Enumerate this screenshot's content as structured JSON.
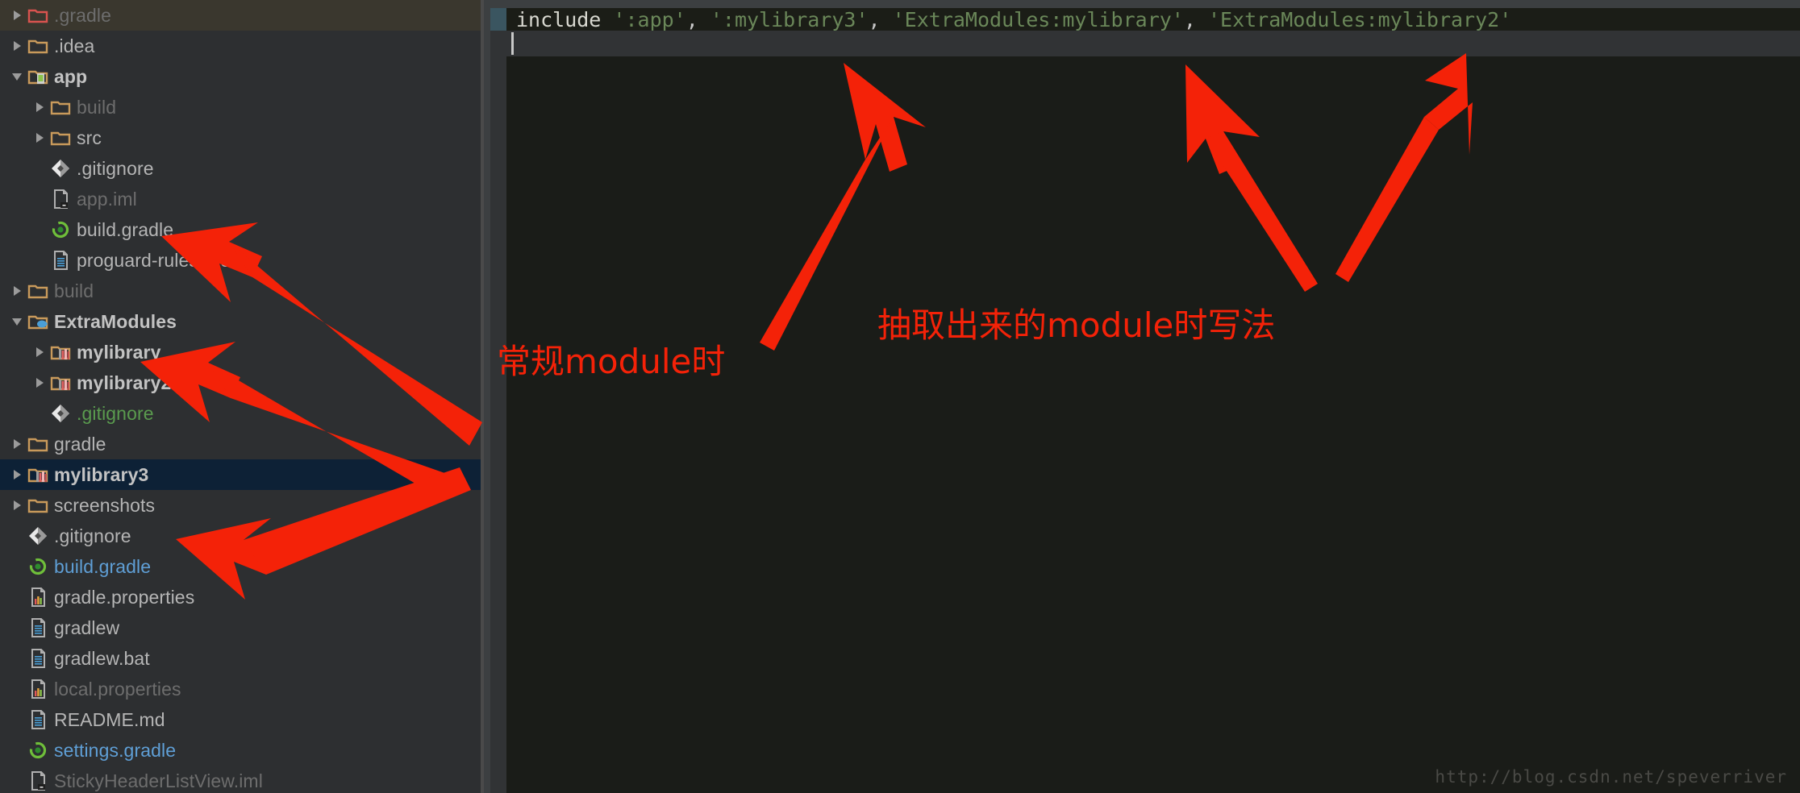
{
  "window": {
    "accent_red": "#f42208",
    "selection_bg": "#0d2136",
    "hover_bg": "#3a372e",
    "panel_bg": "#2d2f31",
    "editor_bg": "#1a1c18"
  },
  "tree": {
    "name": "project-tree",
    "items": [
      {
        "label": ".gradle",
        "indent": 0,
        "twisty": "collapsed",
        "icon": "folder-red-icon",
        "style": "dim",
        "state": "hovered"
      },
      {
        "label": ".idea",
        "indent": 0,
        "twisty": "collapsed",
        "icon": "folder-icon",
        "style": "normal",
        "state": "none"
      },
      {
        "label": "app",
        "indent": 0,
        "twisty": "expanded",
        "icon": "folder-module-icon",
        "style": "bold",
        "state": "none"
      },
      {
        "label": "build",
        "indent": 1,
        "twisty": "collapsed",
        "icon": "folder-icon",
        "style": "dim",
        "state": "none"
      },
      {
        "label": "src",
        "indent": 1,
        "twisty": "collapsed",
        "icon": "folder-icon",
        "style": "normal",
        "state": "none"
      },
      {
        "label": ".gitignore",
        "indent": 1,
        "twisty": "none",
        "icon": "git-icon",
        "style": "normal",
        "state": "none"
      },
      {
        "label": "app.iml",
        "indent": 1,
        "twisty": "none",
        "icon": "iml-file-icon",
        "style": "dim",
        "state": "none"
      },
      {
        "label": "build.gradle",
        "indent": 1,
        "twisty": "none",
        "icon": "gradle-icon",
        "style": "normal",
        "state": "none"
      },
      {
        "label": "proguard-rules.pro",
        "indent": 1,
        "twisty": "none",
        "icon": "text-file-icon",
        "style": "normal",
        "state": "none"
      },
      {
        "label": "build",
        "indent": 0,
        "twisty": "collapsed",
        "icon": "folder-icon",
        "style": "dim",
        "state": "none"
      },
      {
        "label": "ExtraModules",
        "indent": 0,
        "twisty": "expanded",
        "icon": "folder-java-icon",
        "style": "bold",
        "state": "none"
      },
      {
        "label": "mylibrary",
        "indent": 1,
        "twisty": "collapsed",
        "icon": "folder-library-icon",
        "style": "bold",
        "state": "none"
      },
      {
        "label": "mylibrary2",
        "indent": 1,
        "twisty": "collapsed",
        "icon": "folder-library-icon",
        "style": "bold",
        "state": "none"
      },
      {
        "label": ".gitignore",
        "indent": 1,
        "twisty": "none",
        "icon": "git-icon",
        "style": "green",
        "state": "none"
      },
      {
        "label": "gradle",
        "indent": 0,
        "twisty": "collapsed",
        "icon": "folder-icon",
        "style": "normal",
        "state": "none"
      },
      {
        "label": "mylibrary3",
        "indent": 0,
        "twisty": "collapsed",
        "icon": "folder-library-icon",
        "style": "bold",
        "state": "selected"
      },
      {
        "label": "screenshots",
        "indent": 0,
        "twisty": "collapsed",
        "icon": "folder-icon",
        "style": "normal",
        "state": "none"
      },
      {
        "label": ".gitignore",
        "indent": 0,
        "twisty": "none",
        "icon": "git-icon",
        "style": "normal",
        "state": "none"
      },
      {
        "label": "build.gradle",
        "indent": 0,
        "twisty": "none",
        "icon": "gradle-icon",
        "style": "blue",
        "state": "none"
      },
      {
        "label": "gradle.properties",
        "indent": 0,
        "twisty": "none",
        "icon": "properties-file-icon",
        "style": "normal",
        "state": "none"
      },
      {
        "label": "gradlew",
        "indent": 0,
        "twisty": "none",
        "icon": "text-file-icon",
        "style": "normal",
        "state": "none"
      },
      {
        "label": "gradlew.bat",
        "indent": 0,
        "twisty": "none",
        "icon": "text-file-icon",
        "style": "normal",
        "state": "none"
      },
      {
        "label": "local.properties",
        "indent": 0,
        "twisty": "none",
        "icon": "properties-file-icon",
        "style": "dim",
        "state": "none"
      },
      {
        "label": "README.md",
        "indent": 0,
        "twisty": "none",
        "icon": "text-file-icon",
        "style": "normal",
        "state": "none"
      },
      {
        "label": "settings.gradle",
        "indent": 0,
        "twisty": "none",
        "icon": "gradle-icon",
        "style": "blue",
        "state": "none"
      },
      {
        "label": "StickyHeaderListView.iml",
        "indent": 0,
        "twisty": "none",
        "icon": "iml-file-icon",
        "style": "dim",
        "state": "none"
      }
    ]
  },
  "editor": {
    "code": {
      "keyword": "include",
      "space": " ",
      "arg1": "':app'",
      "sep1": ", ",
      "arg2": "':mylibrary3'",
      "sep2": ", ",
      "arg3": "'ExtraModules:mylibrary'",
      "sep3": ", ",
      "arg4": "'ExtraModules:mylibrary2'"
    }
  },
  "annotations": [
    {
      "name": "annotation-normal-module",
      "text": "常规module时"
    },
    {
      "name": "annotation-extracted-module",
      "text": "抽取出来的module时写法"
    }
  ],
  "watermark": {
    "text": "http://blog.csdn.net/speverriver"
  }
}
